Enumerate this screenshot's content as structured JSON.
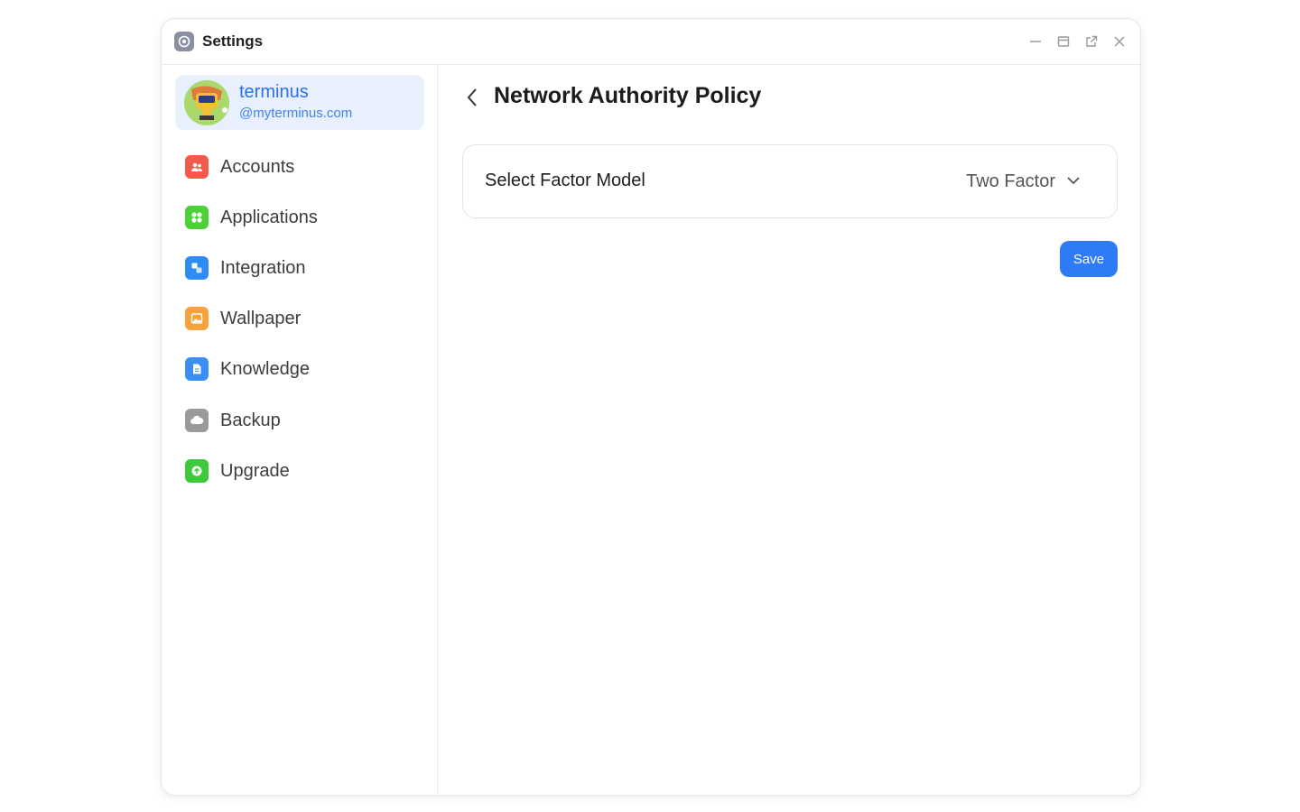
{
  "window": {
    "title": "Settings"
  },
  "profile": {
    "name": "terminus",
    "id": "@myterminus.com"
  },
  "sidebar": {
    "items": [
      {
        "label": "Accounts",
        "icon": "accounts-icon",
        "color": "#f25b4b"
      },
      {
        "label": "Applications",
        "icon": "applications-icon",
        "color": "#4cd137"
      },
      {
        "label": "Integration",
        "icon": "integration-icon",
        "color": "#2f8cf5"
      },
      {
        "label": "Wallpaper",
        "icon": "wallpaper-icon",
        "color": "#f7a23a"
      },
      {
        "label": "Knowledge",
        "icon": "knowledge-icon",
        "color": "#3b8ef3"
      },
      {
        "label": "Backup",
        "icon": "backup-icon",
        "color": "#9a9a9a"
      },
      {
        "label": "Upgrade",
        "icon": "upgrade-icon",
        "color": "#3ec93a"
      }
    ]
  },
  "main": {
    "title": "Network Authority Policy",
    "factor": {
      "label": "Select Factor Model",
      "value": "Two Factor"
    },
    "save_label": "Save"
  },
  "colors": {
    "accent": "#2f7bf5",
    "profile_bg": "#e9f0fd"
  }
}
